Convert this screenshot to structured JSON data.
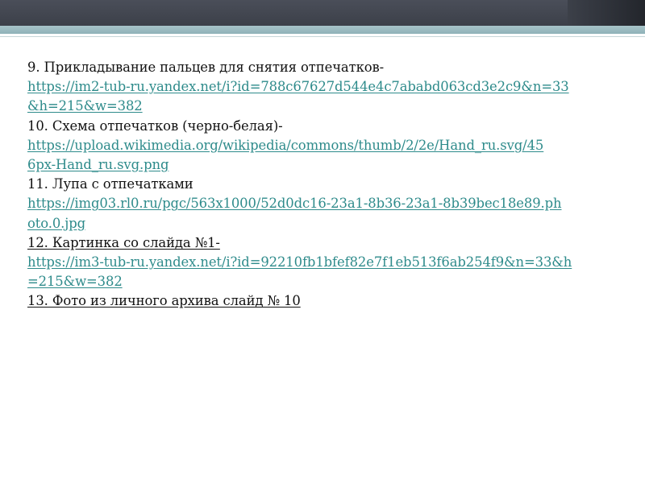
{
  "references": [
    {
      "label": "9. Прикладывание пальцев для снятия отпечатков-",
      "url_lines": [
        "https://im2-tub-ru.yandex.net/i?id=788c67627d544e4c7ababd063cd3e2c9&n=33",
        "&h=215&w=382"
      ]
    },
    {
      "label": "10. Схема отпечатков (черно-белая)-",
      "url_lines": [
        "https://upload.wikimedia.org/wikipedia/commons/thumb/2/2e/Hand_ru.svg/45",
        "6px-Hand_ru.svg.png"
      ]
    },
    {
      "label": "11. Лупа с отпечатками",
      "url_lines": [
        "https://img03.rl0.ru/pgc/563x1000/52d0dc16-23a1-8b36-23a1-8b39bec18e89.ph",
        "oto.0.jpg"
      ]
    },
    {
      "label": "12. Картинка со слайда №1-",
      "url_lines": [
        "https://im3-tub-ru.yandex.net/i?id=92210fb1bfef82e7f1eb513f6ab254f9&n=33&h",
        "=215&w=382"
      ]
    },
    {
      "label": "13. Фото из личного архива слайд № 10",
      "url_lines": []
    }
  ],
  "colors": {
    "header_dark": "#3c4049",
    "header_teal": "#9dbcc1",
    "link": "#2e8b8b",
    "text": "#111111"
  }
}
